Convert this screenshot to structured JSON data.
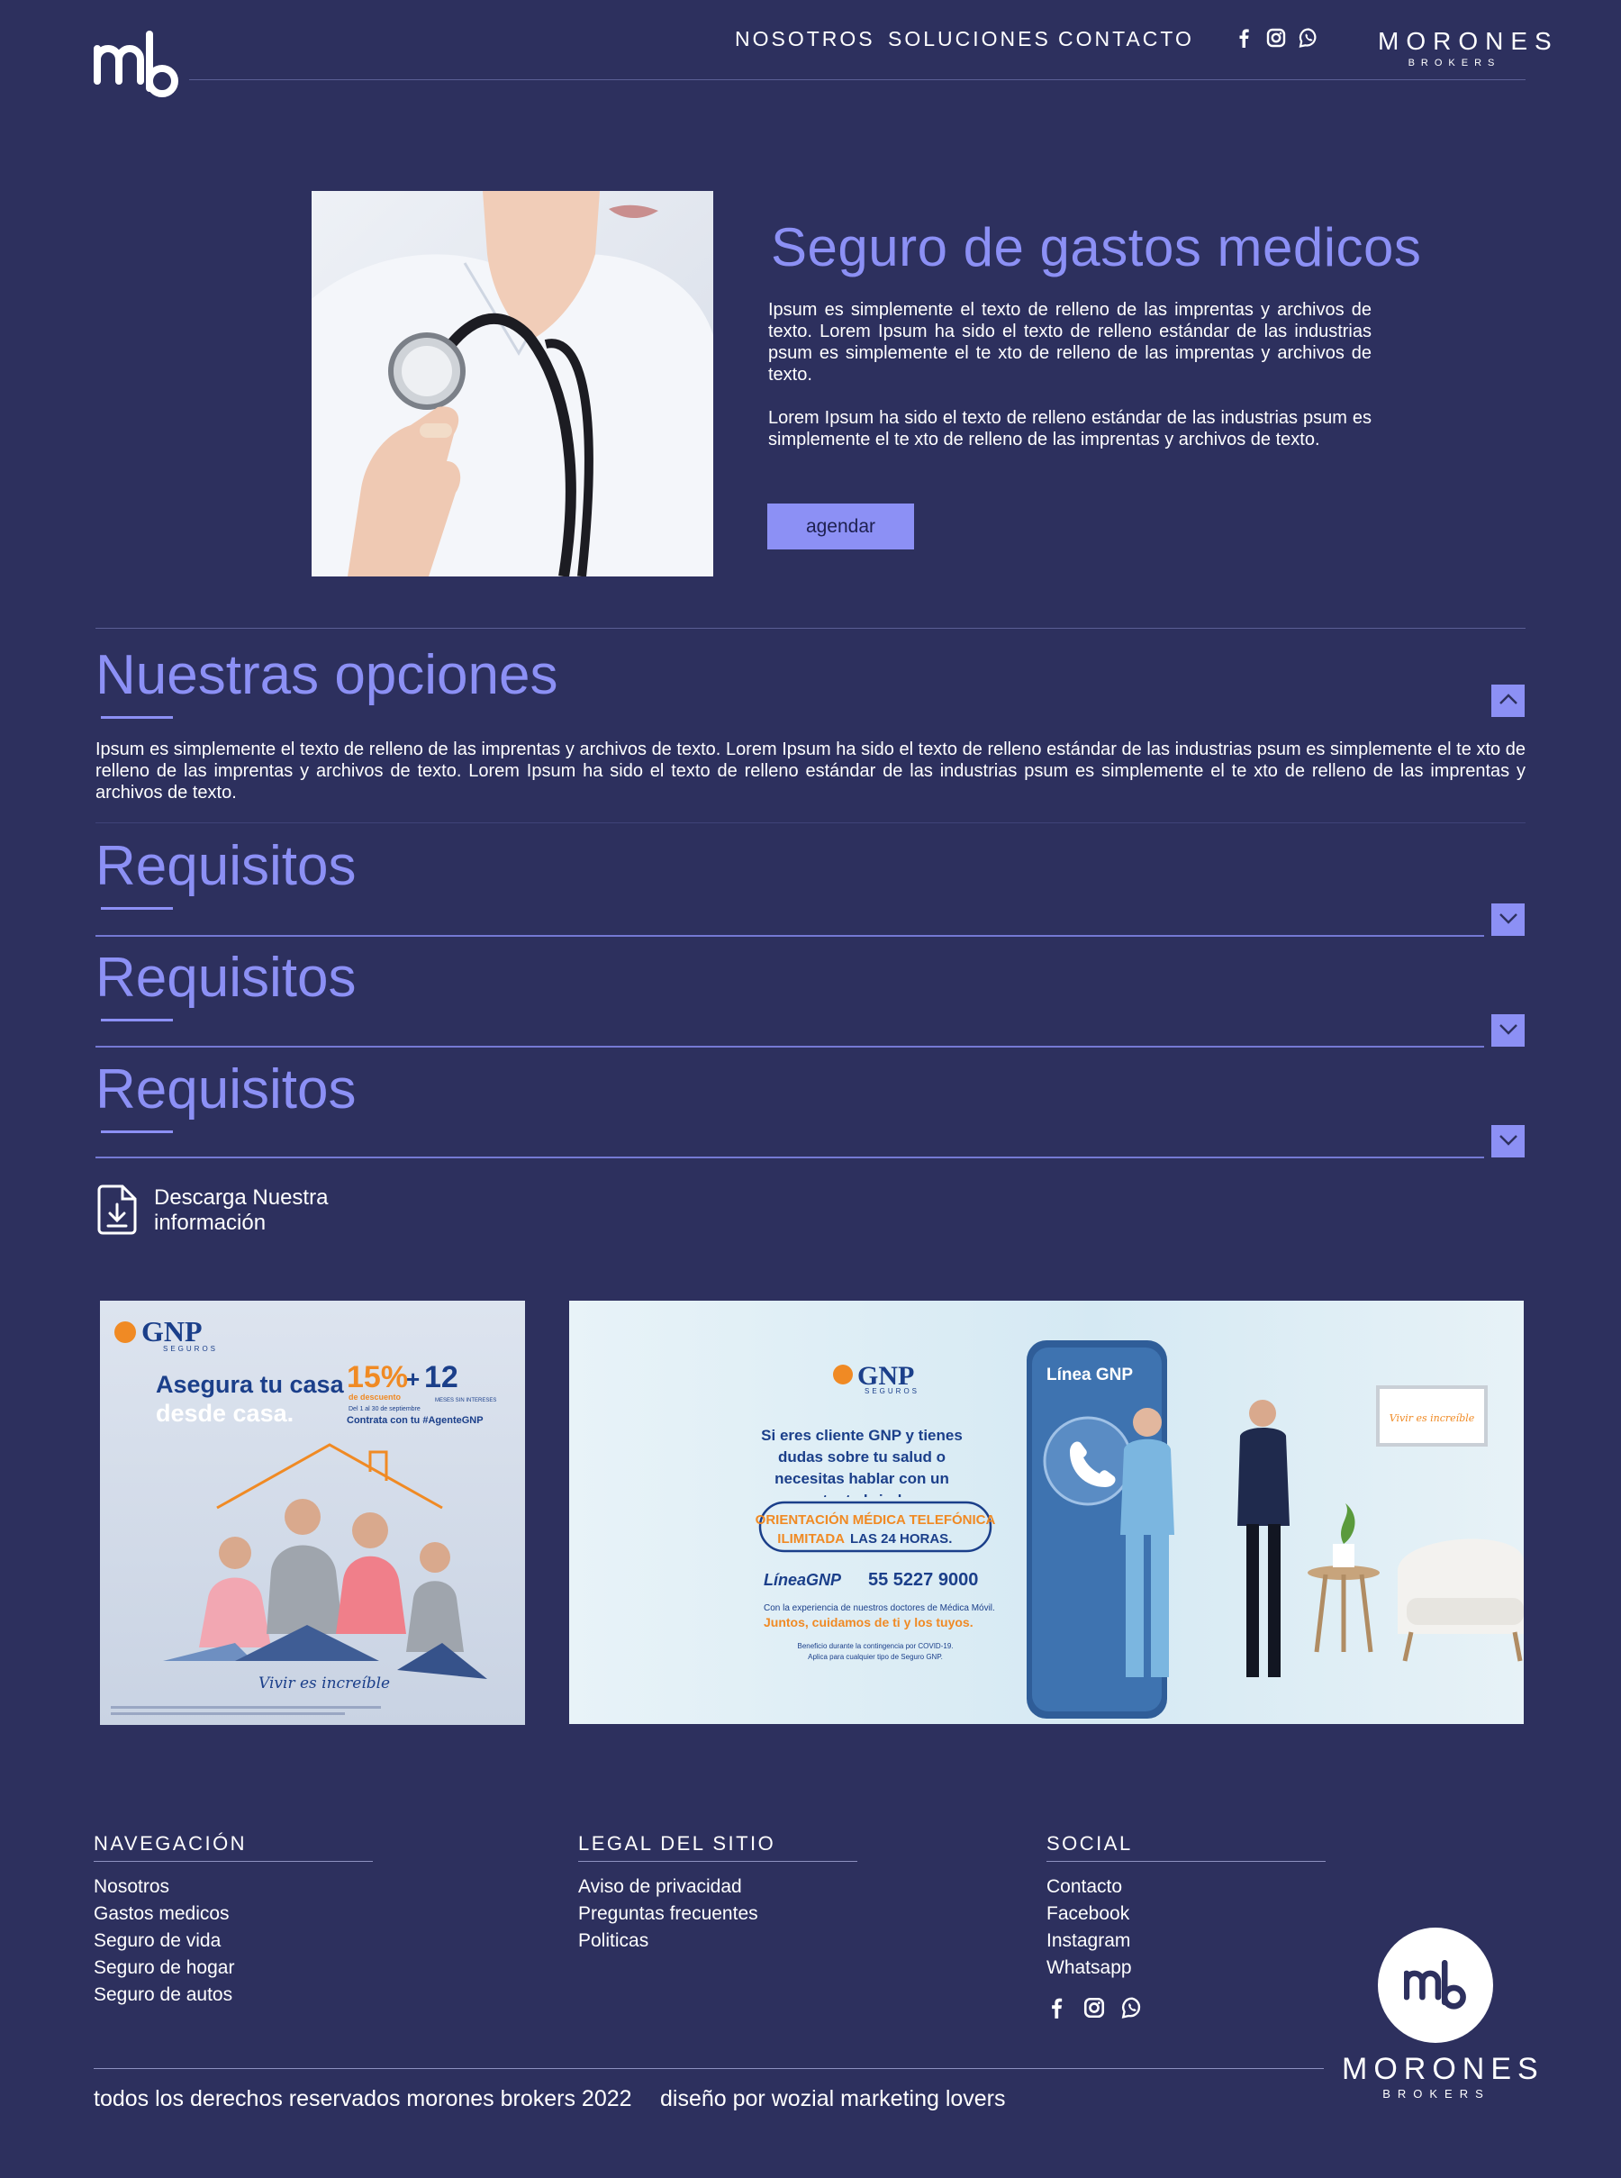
{
  "header": {
    "nav": [
      "NOSOTROS",
      "SOLUCIONES",
      "CONTACTO"
    ],
    "brand_name": "MORONES",
    "brand_sub": "BROKERS",
    "social_icons": [
      "facebook-icon",
      "instagram-icon",
      "whatsapp-icon"
    ]
  },
  "hero": {
    "title": "Seguro de gastos medicos",
    "paragraph1": "Ipsum es simplemente el texto de  relleno de las imprentas y  archivos de texto.  Lorem Ipsum ha sido el texto de relleno estándar de las industrias psum es simplemente el te xto de relleno de las imprentas y archivos de texto.",
    "paragraph2": "Lorem Ipsum ha sido el texto de relleno estándar de las industrias psum es simplemente el te xto de relleno de las imprentas y archivos de texto.",
    "cta": "agendar"
  },
  "accordion": [
    {
      "title": "Nuestras opciones",
      "expanded": true,
      "body": "Ipsum es simplemente el texto de  relleno de las imprentas y  archivos de texto.  Lorem Ipsum ha sido el texto de relleno estándar de las industrias psum es simplemente el te xto de relleno de las imprentas y archivos de texto.  Lorem Ipsum ha sido el texto de relleno estándar de las industrias psum es simplemente el te xto de relleno de las imprentas y archivos de texto."
    },
    {
      "title": "Requisitos",
      "expanded": false
    },
    {
      "title": "Requisitos",
      "expanded": false
    },
    {
      "title": "Requisitos",
      "expanded": false
    }
  ],
  "download": {
    "line1": "Descarga Nuestra",
    "line2": "información"
  },
  "banner1": {
    "brand": "GNP",
    "brand_sub": "SEGUROS",
    "headline1": "Asegura tu casa",
    "headline2": "desde casa.",
    "discount": "15%",
    "discount_label": "de descuento",
    "plus": "+",
    "months": "12",
    "months_label": "MESES SIN INTERESES",
    "dates": "Del 1 al 30 de septiembre",
    "contract": "Contrata con tu #AgenteGNP",
    "slogan": "Vivir es increíble"
  },
  "banner2": {
    "brand": "GNP",
    "brand_sub": "SEGUROS",
    "intro": "Si eres cliente GNP y tienes dudas sobre tu salud o necesitas hablar con un experto, te brindamos",
    "badge1": "ORIENTACIÓN MÉDICA TELEFÓNICA",
    "badge2_a": "ILIMITADA",
    "badge2_b": "LAS 24 HORAS.",
    "line_label": "LíneaGNP",
    "phone": "55 5227 9000",
    "experience": "Con la experiencia de nuestros doctores de Médica Móvil.",
    "care": "Juntos, cuidamos de ti y los tuyos.",
    "fine1": "Beneficio durante la contingencia por COVID-19.",
    "fine2": "Aplica para cualquier tipo de Seguro GNP.",
    "phone_screen": "Línea GNP",
    "frame_text": "Vivir es increíble"
  },
  "footer": {
    "nav_title": "NAVEGACIÓN",
    "nav_items": [
      "Nosotros",
      "Gastos medicos",
      "Seguro de vida",
      "Seguro de hogar",
      "Seguro de autos"
    ],
    "legal_title": "LEGAL DEL SITIO",
    "legal_items": [
      "Aviso de privacidad",
      "Preguntas frecuentes",
      "Politicas"
    ],
    "social_title": "SOCIAL",
    "social_items": [
      "Contacto",
      "Facebook",
      "Instagram",
      "Whatsapp"
    ],
    "copyright": "todos los derechos reservados morones brokers 2022",
    "credits": "diseño por wozial marketing lovers",
    "brand_name": "MORONES",
    "brand_sub": "BROKERS"
  },
  "colors": {
    "background": "#2d305e",
    "accent": "#8c90f5",
    "text": "#ffffff"
  }
}
